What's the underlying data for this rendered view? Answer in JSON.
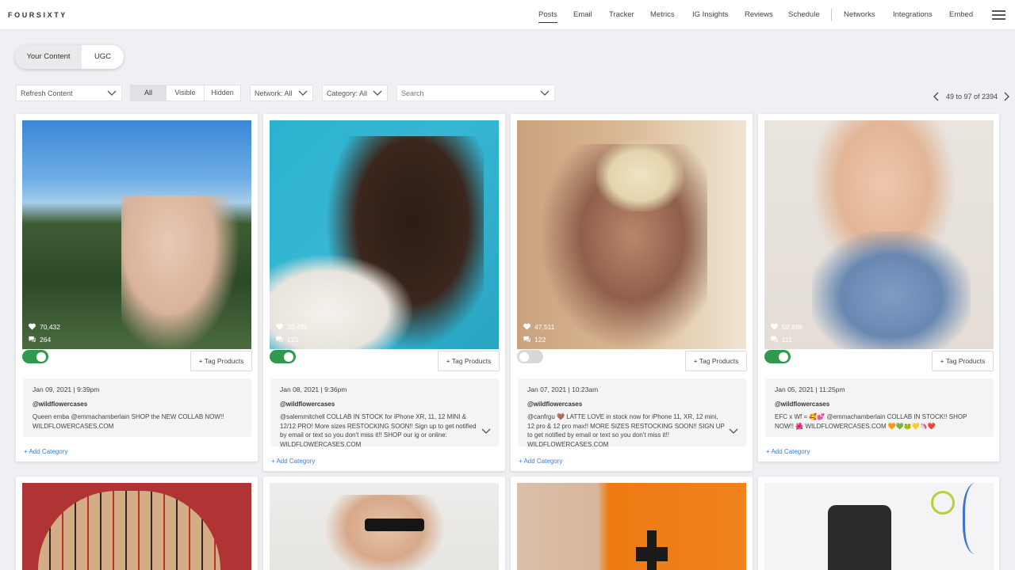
{
  "app": {
    "logo": "FOURSIXTY"
  },
  "nav": {
    "items": [
      "Posts",
      "Email",
      "Tracker",
      "Metrics",
      "IG Insights",
      "Reviews",
      "Schedule",
      "Networks",
      "Integrations",
      "Embed"
    ],
    "active": "Posts",
    "menu_icon": "hamburger-menu-icon"
  },
  "content_switch": {
    "your_content": "Your Content",
    "ugc": "UGC",
    "selected": "Your Content"
  },
  "filters": {
    "refresh": "Refresh Content",
    "visibility": [
      "All",
      "Visible",
      "Hidden"
    ],
    "visibility_selected": "All",
    "network": "Network: All",
    "category": "Category: All",
    "search_placeholder": "Search"
  },
  "pagination": {
    "range": "49 to 97 of 2394"
  },
  "labels": {
    "tag_products": "+ Tag Products",
    "add_category": "+ Add Category"
  },
  "colors": {
    "toggle_on": "#2f9a4f",
    "toggle_off": "#d8d8d8",
    "link": "#3d7bd6",
    "page_bg": "#eef0f3"
  },
  "posts": [
    {
      "likes": "70,432",
      "comments": "264",
      "visible": true,
      "date": "Jan 09, 2021 | 9:39pm",
      "user": "@wildflowercases",
      "caption": "Queen emba @emmachamberlain SHOP the NEW COLLAB NOW!! WILDFLOWERCASES.COM",
      "expandable": false
    },
    {
      "likes": "38,435",
      "comments": "123",
      "visible": true,
      "date": "Jan 08, 2021 | 9:36pm",
      "user": "@wildflowercases",
      "caption": "@salemmitchell COLLAB IN STOCK for iPhone XR, 11, 12 MINI & 12/12 PRO! More sizes RESTOCKING SOON!! Sign up to get notified by email or text so you don't miss it!! SHOP our ig or online: WILDFLOWERCASES.COM",
      "expandable": true
    },
    {
      "likes": "47,511",
      "comments": "122",
      "visible": false,
      "date": "Jan 07, 2021 | 10:23am",
      "user": "@wildflowercases",
      "caption": "@canfrgu 🤎 LATTE LOVE in stock now for iPhone 11, XR, 12 mini, 12 pro & 12 pro max!! MORE SIZES RESTOCKING SOON!! SIGN UP to get notified by email or text so you don't miss it!! WILDFLOWERCASES.COM",
      "expandable": true
    },
    {
      "likes": "59,898",
      "comments": "111",
      "visible": true,
      "date": "Jan 05, 2021 | 11:25pm",
      "user": "@wildflowercases",
      "caption": "EFC x Wf = 🥰💕 @emmachamberlain COLLAB IN STOCK!! SHOP NOW!! 🌺 WILDFLOWERCASES.COM 🧡💚🐸💛🦄❤️",
      "expandable": false
    }
  ]
}
